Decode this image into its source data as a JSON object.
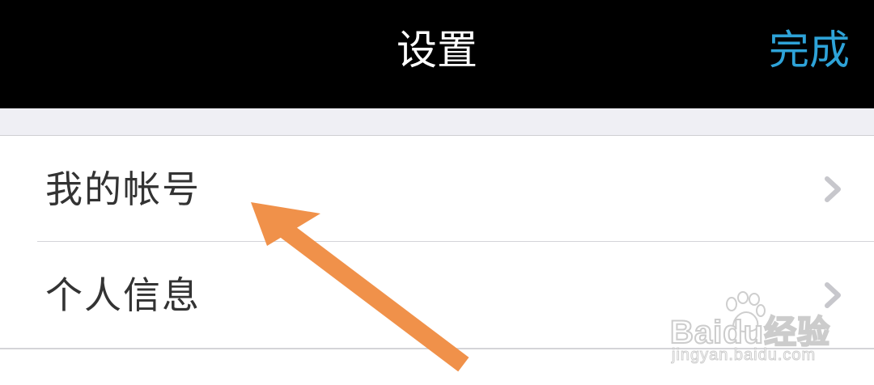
{
  "navbar": {
    "title": "设置",
    "done_label": "完成"
  },
  "settings_list": {
    "items": [
      {
        "label": "我的帐号",
        "icon": "chevron-right-icon"
      },
      {
        "label": "个人信息",
        "icon": "chevron-right-icon"
      }
    ]
  },
  "annotation": {
    "arrow_color": "#f0914a"
  },
  "watermark": {
    "brand": "Baidu经验",
    "url": "jingyan.baidu.com"
  },
  "colors": {
    "navbar_bg": "#000000",
    "accent": "#2ea3d8",
    "text": "#333333",
    "chevron": "#c7c7cc"
  }
}
